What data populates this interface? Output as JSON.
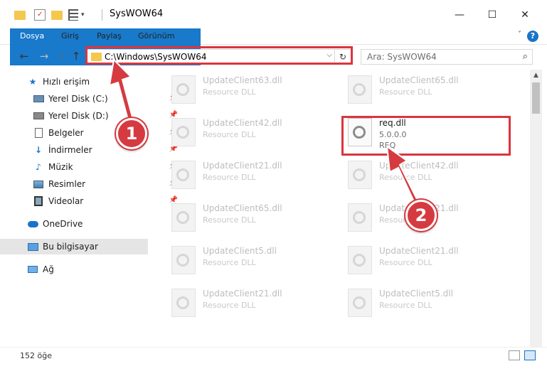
{
  "window": {
    "title": "SysWOW64",
    "controls": {
      "minimize": "—",
      "maximize": "☐",
      "close": "✕"
    }
  },
  "ribbon": {
    "tabs": [
      {
        "label": "Dosya",
        "active": true
      },
      {
        "label": "Giriş"
      },
      {
        "label": "Paylaş"
      },
      {
        "label": "Görünüm"
      }
    ],
    "help": "?"
  },
  "navigation": {
    "address": "C:\\Windows\\SysWOW64",
    "search_placeholder": "Ara: SysWOW64"
  },
  "sidebar": {
    "items": [
      {
        "label": "Hızlı erişim",
        "icon": "star-icon"
      },
      {
        "label": "Yerel Disk (C:)",
        "icon": "drive-icon",
        "pinned": true
      },
      {
        "label": "Yerel Disk (D:)",
        "icon": "drive-icon",
        "pinned": true
      },
      {
        "label": "Belgeler",
        "icon": "documents-icon",
        "pinned": true
      },
      {
        "label": "İndirmeler",
        "icon": "download-icon",
        "pinned": true
      },
      {
        "label": "Müzik",
        "icon": "music-icon",
        "pinned": true
      },
      {
        "label": "Resimler",
        "icon": "pictures-icon",
        "pinned": true
      },
      {
        "label": "Videolar",
        "icon": "videos-icon",
        "pinned": true
      },
      {
        "label": "OneDrive",
        "icon": "cloud-icon"
      },
      {
        "label": "Bu bilgisayar",
        "icon": "computer-icon",
        "selected": true
      },
      {
        "label": "Ağ",
        "icon": "network-icon"
      }
    ]
  },
  "files": [
    {
      "name": "UpdateClient63.dll",
      "type": "Resource DLL"
    },
    {
      "name": "UpdateClient65.dll",
      "type": "Resource DLL"
    },
    {
      "name": "UpdateClient42.dll",
      "type": "Resource DLL"
    },
    {
      "name": "req.dll",
      "type": "5.0.0.0",
      "extra": "REQ",
      "highlighted": true
    },
    {
      "name": "UpdateClient21.dll",
      "type": "Resource DLL"
    },
    {
      "name": "UpdateClient42.dll",
      "type": "Resource DLL"
    },
    {
      "name": "UpdateClient65.dll",
      "type": "Resource DLL"
    },
    {
      "name": "UpdateClient21.dll",
      "type": "Resource DLL"
    },
    {
      "name": "UpdateClient5.dll",
      "type": "Resource DLL"
    },
    {
      "name": "UpdateClient21.dll",
      "type": "Resource DLL"
    },
    {
      "name": "UpdateClient21.dll",
      "type": "Resource DLL"
    },
    {
      "name": "UpdateClient5.dll",
      "type": "Resource DLL"
    }
  ],
  "status": {
    "count": "152 öğe"
  },
  "annotations": {
    "step1": "1",
    "step2": "2",
    "color": "#d63a41"
  }
}
